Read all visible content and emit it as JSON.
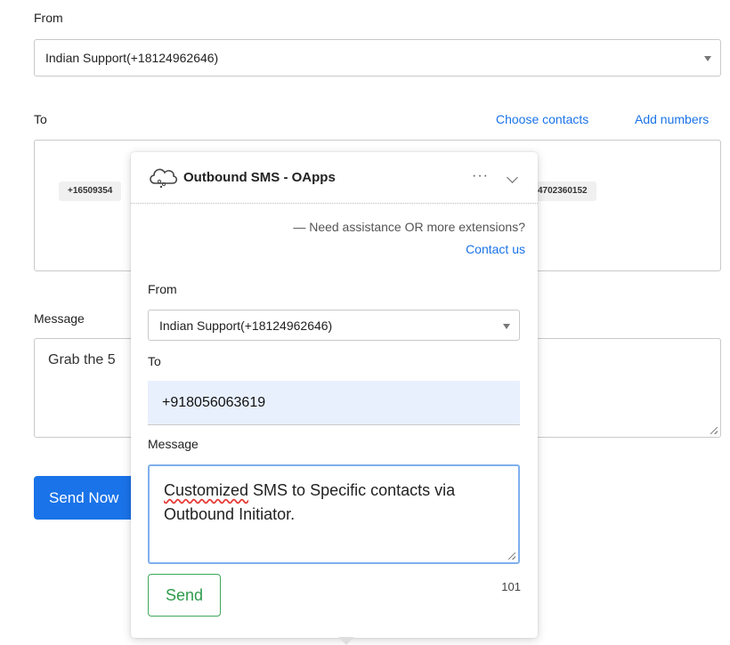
{
  "form": {
    "from_label": "From",
    "from_value": "Indian Support(+18124962646)",
    "to_label": "To",
    "choose_contacts": "Choose contacts",
    "add_numbers": "Add numbers",
    "chips": [
      "+16509354",
      "4702360152"
    ],
    "message_label": "Message",
    "message_value": "Grab the 5",
    "send_now": "Send Now"
  },
  "popup": {
    "title": "Outbound SMS - OApps",
    "menu": "···",
    "assist_text": "— Need assistance OR more extensions?",
    "contact_link": "Contact us",
    "from_label": "From",
    "from_value": "Indian Support(+18124962646)",
    "to_label": "To",
    "to_value": "+918056063619",
    "message_label": "Message",
    "message_word1": "Customized",
    "message_rest": " SMS to Specific contacts via Outbound Initiator.",
    "char_count": "101",
    "send_label": "Send"
  }
}
